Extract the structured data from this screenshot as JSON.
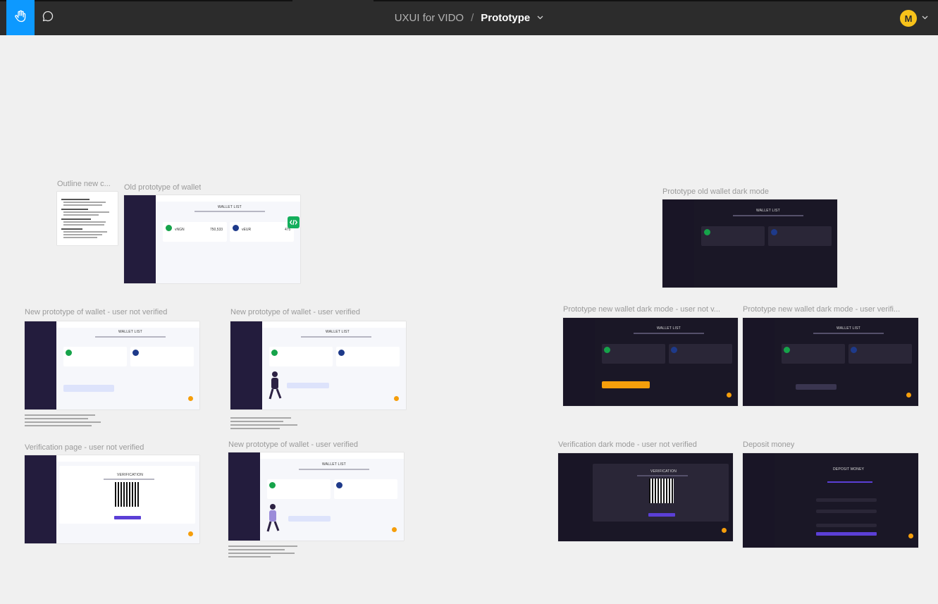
{
  "toolbar": {
    "tools": [
      "hand-tool",
      "comment-tool"
    ],
    "active_tool": "hand-tool"
  },
  "document": {
    "project": "UXUI for VIDO",
    "separator": "/",
    "page": "Prototype"
  },
  "user": {
    "initial": "M",
    "avatar_color": "#f7c21a"
  },
  "accent": "#0d99ff",
  "frames": [
    {
      "id": "outline",
      "label": "Outline new c..."
    },
    {
      "id": "old-proto",
      "label": "Old prototype of wallet"
    },
    {
      "id": "old-dark",
      "label": "Prototype old wallet dark mode"
    },
    {
      "id": "new-not-verified",
      "label": "New prototype of wallet - user not verified"
    },
    {
      "id": "new-verified",
      "label": "New prototype of wallet - user verified"
    },
    {
      "id": "new-dark-not-verified",
      "label": "Prototype new wallet dark mode - user not v..."
    },
    {
      "id": "new-dark-verified",
      "label": "Prototype new wallet dark mode - user verifi..."
    },
    {
      "id": "verification",
      "label": "Verification page - user not verified"
    },
    {
      "id": "new-verified-2",
      "label": "New prototype of wallet - user verified"
    },
    {
      "id": "verification-dark",
      "label": "Verification dark mode - user not verified"
    },
    {
      "id": "deposit",
      "label": "Deposit money"
    }
  ],
  "frame_content": {
    "wallet_title": "WALLET LIST",
    "verification_title": "VERIFICATION",
    "deposit_title": "DEPOSIT MONEY",
    "coin1": {
      "name": "vNGN",
      "amount": "750,533"
    },
    "coin2": {
      "name": "vEUR",
      "amount": "475"
    }
  }
}
